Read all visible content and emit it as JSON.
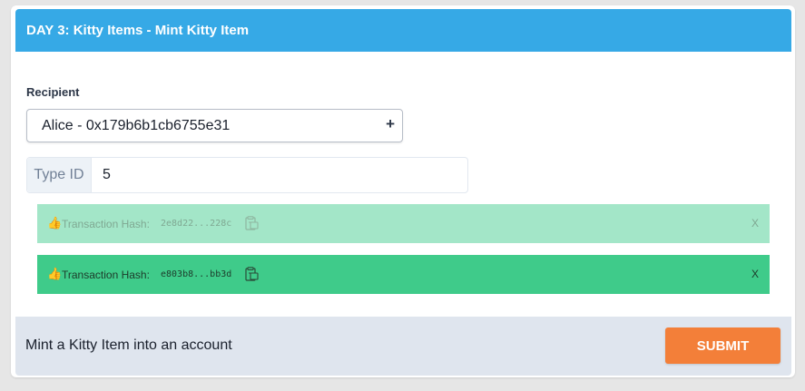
{
  "card": {
    "title": "DAY 3: Kitty Items - Mint Kitty Item"
  },
  "recipient": {
    "label": "Recipient",
    "selected": "Alice - 0x179b6b1cb6755e31",
    "arrow_icon": "plus-icon"
  },
  "type_id": {
    "label": "Type ID",
    "value": "5"
  },
  "transactions": [
    {
      "emoji": "👍",
      "label": "Transaction Hash:",
      "hash": "2e8d22...228c",
      "close": "X",
      "color": "#a3e6c8"
    },
    {
      "emoji": "👍",
      "label": "Transaction Hash:",
      "hash": "e803b8...bb3d",
      "close": "X",
      "color": "#3fcb8a"
    }
  ],
  "footer": {
    "text": "Mint a Kitty Item into an account",
    "submit_label": "SUBMIT",
    "submit_color": "#f37f39"
  },
  "colors": {
    "header": "#36a9e6",
    "footer_bg": "#dfe5ee"
  }
}
